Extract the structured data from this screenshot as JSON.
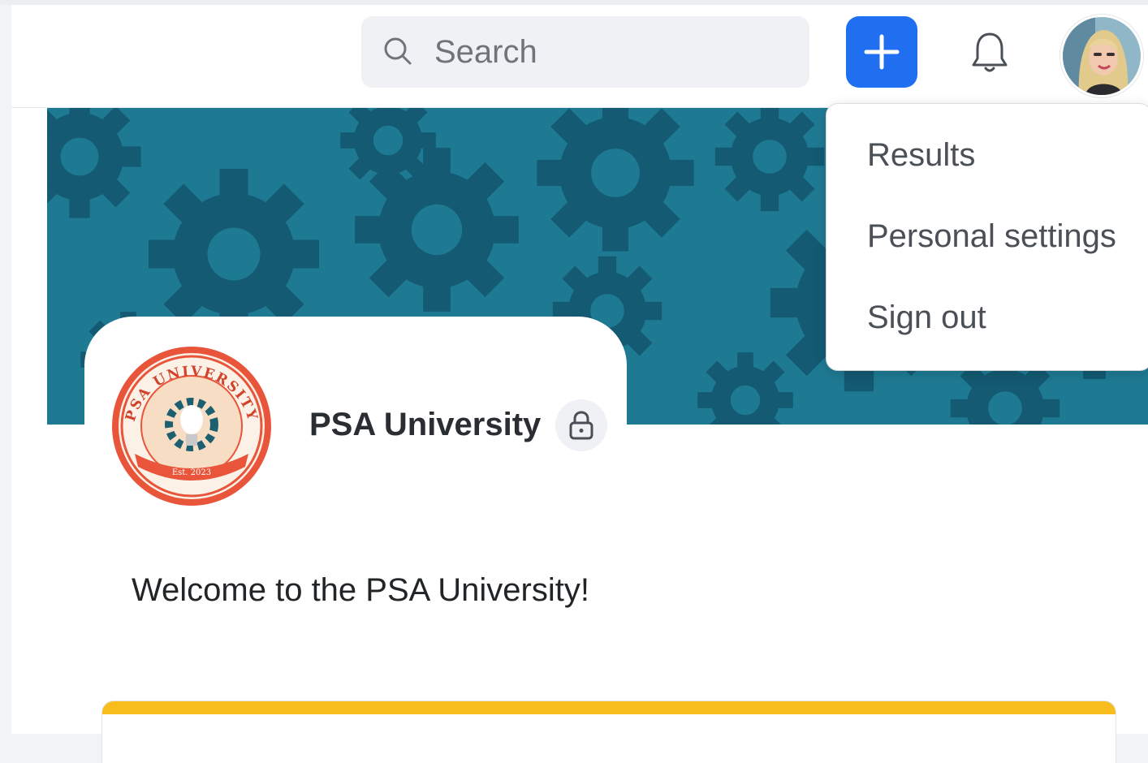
{
  "topbar": {
    "search": {
      "placeholder": "Search"
    },
    "add_button": {
      "icon": "plus-icon",
      "color": "#1f6ff0"
    },
    "notifications": {
      "icon": "bell-icon"
    },
    "avatar": {
      "icon": "user-avatar"
    }
  },
  "banner": {
    "color": "#1e7a93",
    "pattern": "gears"
  },
  "org": {
    "name": "PSA University",
    "seal_text": "PSA UNIVERSITY",
    "seal_est": "Est. 2023",
    "privacy": "lock-icon"
  },
  "main": {
    "welcome": "Welcome to the PSA University!",
    "card_accent": "#f7bd1c"
  },
  "dropdown": {
    "items": [
      {
        "label": "Results"
      },
      {
        "label": "Personal settings"
      },
      {
        "label": "Sign out"
      }
    ]
  }
}
